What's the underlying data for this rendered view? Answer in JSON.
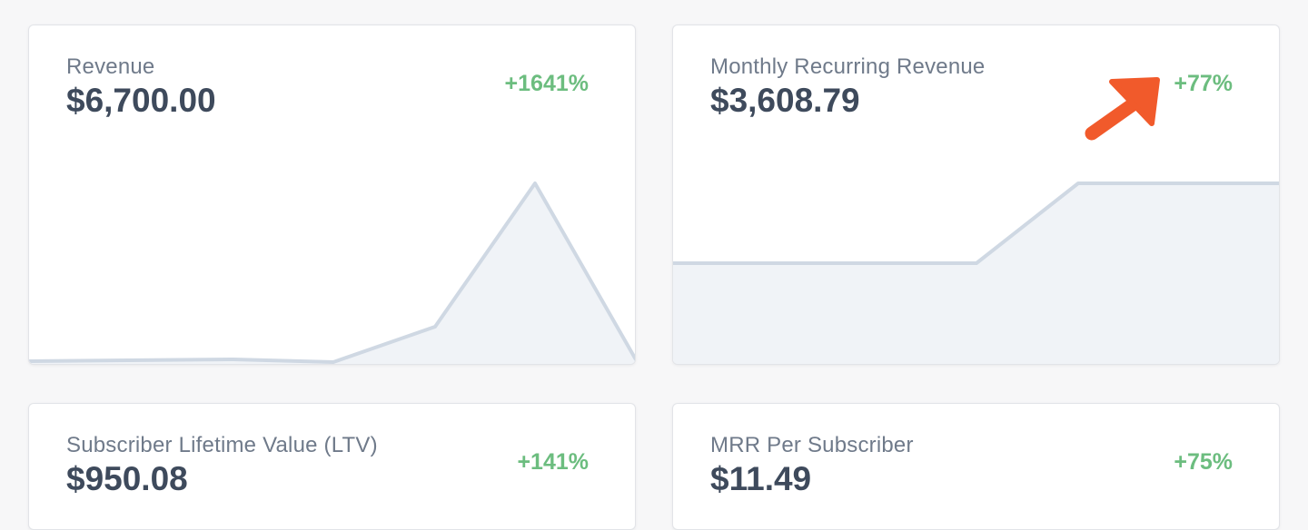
{
  "metrics": [
    {
      "label": "Revenue",
      "value": "$6,700.00",
      "change": "+1641%"
    },
    {
      "label": "Monthly Recurring Revenue",
      "value": "$3,608.79",
      "change": "+77%"
    },
    {
      "label": "Subscriber Lifetime Value (LTV)",
      "value": "$950.08",
      "change": "+141%"
    },
    {
      "label": "MRR Per Subscriber",
      "value": "$11.49",
      "change": "+75%"
    }
  ],
  "colors": {
    "positive": "#6cbd7f",
    "arrow": "#f15a2b",
    "chart_fill": "#f0f3f7",
    "chart_line": "#cfd8e3"
  },
  "annotation": {
    "icon": "arrow-up-right-icon"
  }
}
